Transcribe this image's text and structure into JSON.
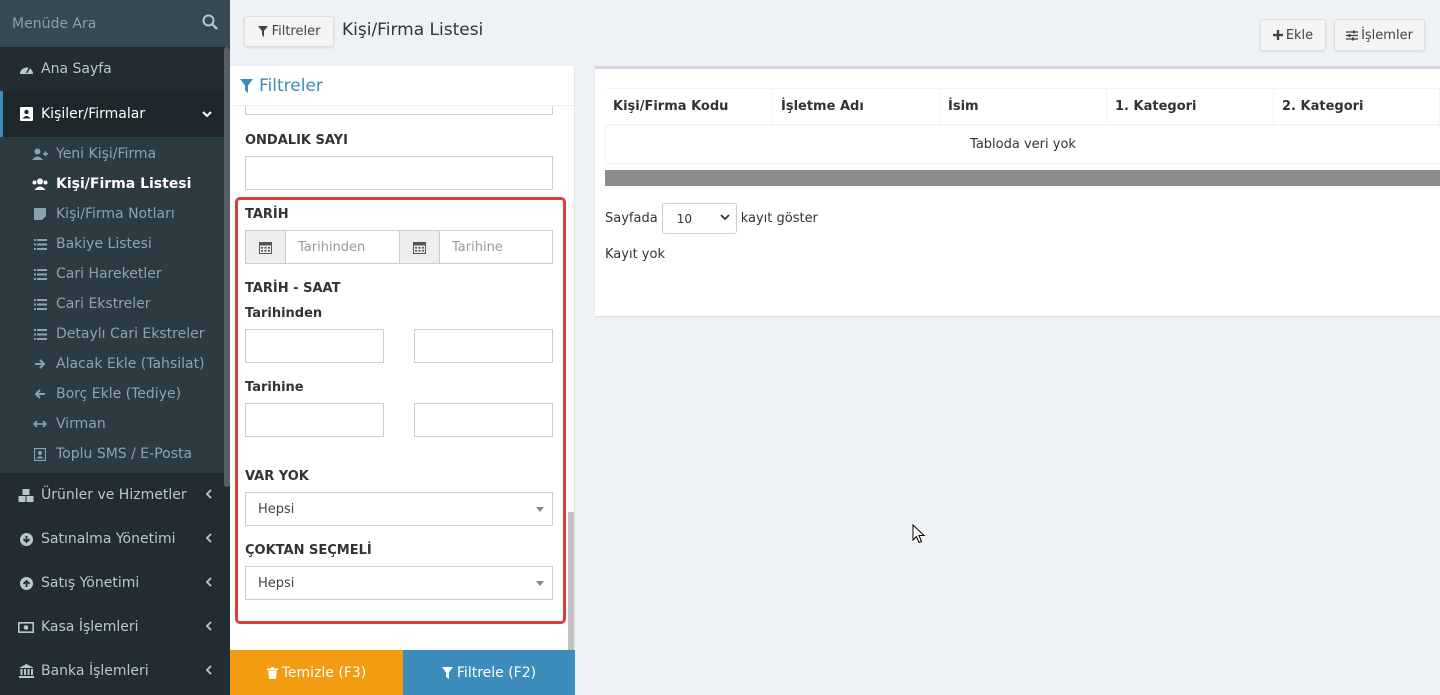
{
  "sidebar": {
    "search_placeholder": "Menüde Ara",
    "items": [
      {
        "label": "Ana Sayfa",
        "icon": "dashboard-icon"
      },
      {
        "label": "Kişiler/Firmalar",
        "icon": "address-card-icon"
      },
      {
        "label": "Ürünler ve Hizmetler",
        "icon": "cubes-icon"
      },
      {
        "label": "Satınalma Yönetimi",
        "icon": "download-circle-icon"
      },
      {
        "label": "Satış Yönetimi",
        "icon": "upload-circle-icon"
      },
      {
        "label": "Kasa İşlemleri",
        "icon": "money-icon"
      },
      {
        "label": "Banka İşlemleri",
        "icon": "bank-icon"
      }
    ],
    "submenu": [
      {
        "label": "Yeni Kişi/Firma",
        "icon": "user-plus-icon"
      },
      {
        "label": "Kişi/Firma Listesi",
        "icon": "users-icon"
      },
      {
        "label": "Kişi/Firma Notları",
        "icon": "sticky-note-icon"
      },
      {
        "label": "Bakiye Listesi",
        "icon": "list-icon"
      },
      {
        "label": "Cari Hareketler",
        "icon": "list-icon"
      },
      {
        "label": "Cari Ekstreler",
        "icon": "list-icon"
      },
      {
        "label": "Detaylı Cari Ekstreler",
        "icon": "list-icon"
      },
      {
        "label": "Alacak Ekle (Tahsilat)",
        "icon": "arrow-right-icon"
      },
      {
        "label": "Borç Ekle (Tediye)",
        "icon": "arrow-left-icon"
      },
      {
        "label": "Virman",
        "icon": "arrows-h-icon"
      },
      {
        "label": "Toplu SMS / E-Posta",
        "icon": "contact-icon"
      }
    ]
  },
  "topbar": {
    "filters_label": "Filtreler",
    "title": "Kişi/Firma Listesi",
    "add_label": "Ekle",
    "ops_label": "İşlemler"
  },
  "filter_panel": {
    "title": "Filtreler",
    "decimal_label": "ONDALIK SAYI",
    "date_label": "TARİH",
    "date_from_placeholder": "Tarihinden",
    "date_to_placeholder": "Tarihine",
    "datetime_label": "TARİH - SAAT",
    "from_label": "Tarihinden",
    "to_label": "Tarihine",
    "varyok_label": "VAR YOK",
    "varyok_value": "Hepsi",
    "multi_label": "ÇOKTAN SEÇMELİ",
    "multi_value": "Hepsi",
    "clear_label": "Temizle (F3)",
    "filter_label": "Filtrele (F2)"
  },
  "table": {
    "columns": [
      "Kişi/Firma Kodu",
      "İşletme Adı",
      "İsim",
      "1. Kategori",
      "2. Kategori"
    ],
    "empty_text": "Tabloda veri yok",
    "length_prefix": "Sayfada",
    "length_value": "10",
    "length_suffix": "kayıt göster",
    "info": "Kayıt yok"
  },
  "colors": {
    "sidebar_bg": "#222d32",
    "accent": "#3c8dbc",
    "clear_button": "#f39c12",
    "highlight": "#e03c3c"
  }
}
